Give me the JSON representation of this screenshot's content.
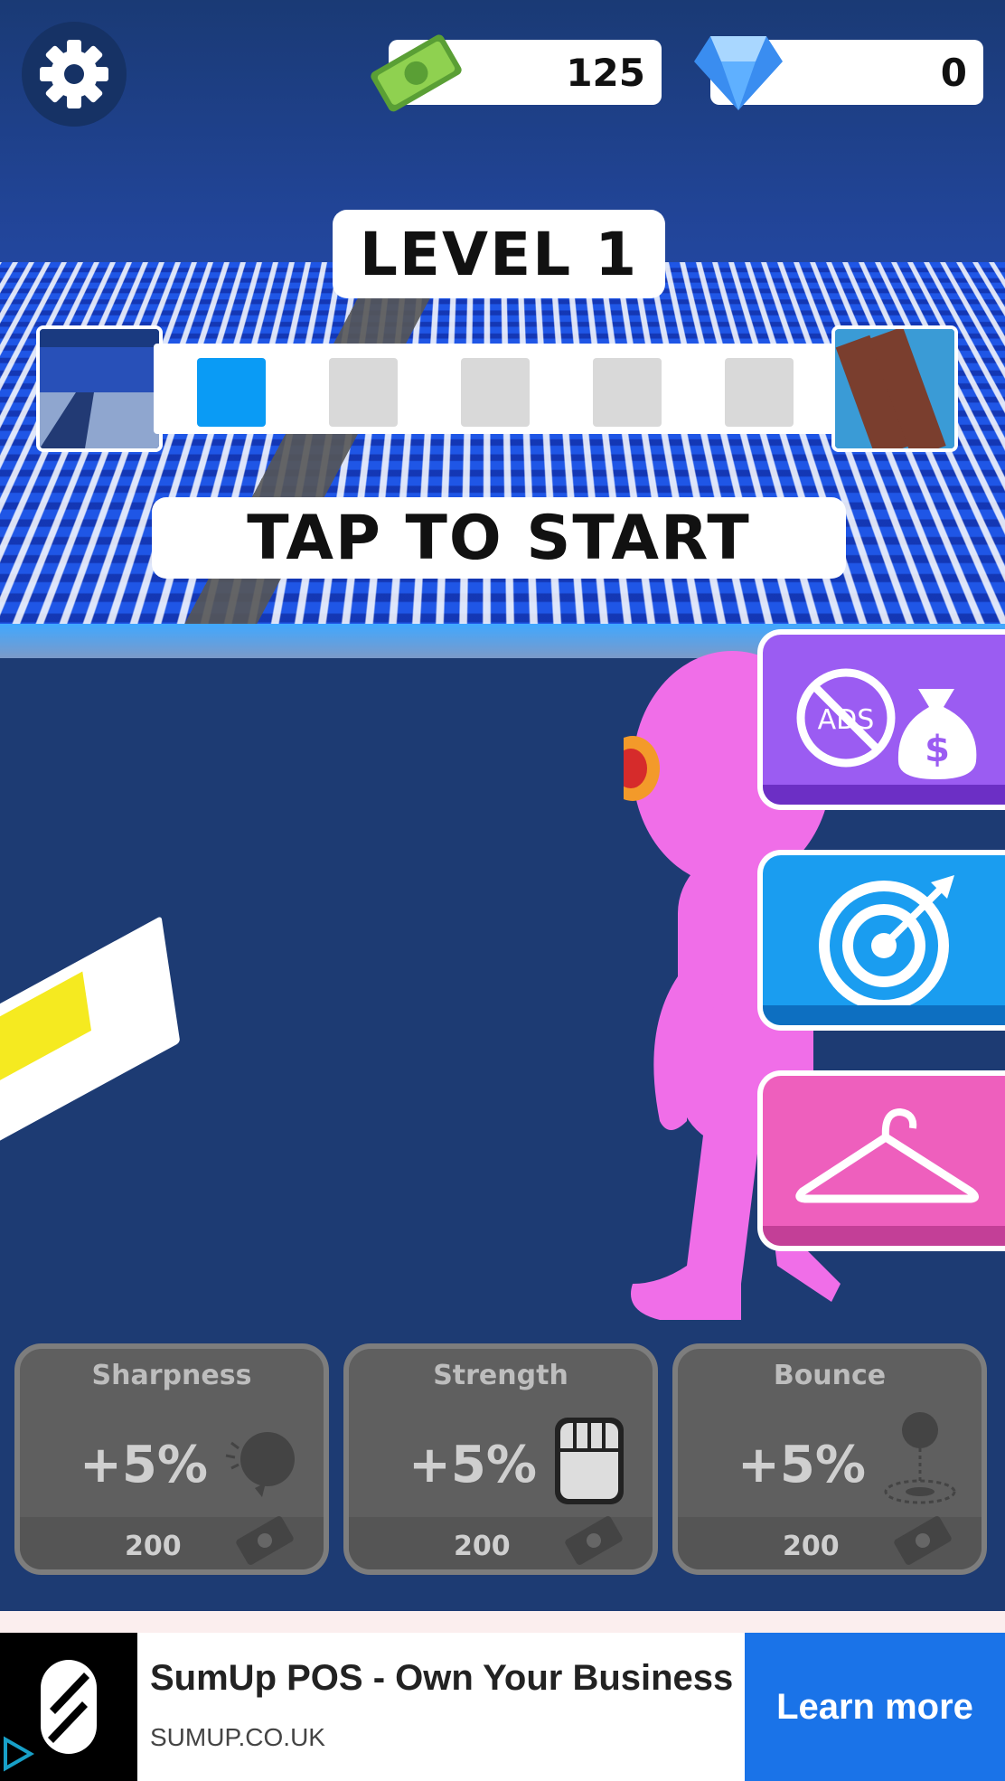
{
  "hud": {
    "cash_amount": "125",
    "gem_amount": "0"
  },
  "level": {
    "title": "LEVEL 1",
    "stages_total": 5,
    "stages_completed": 1,
    "prompt": "TAP TO START"
  },
  "side_buttons": [
    {
      "name": "no-ads-offer",
      "icon": "no-ads-money-bag-icon",
      "color": "#9b5cf2"
    },
    {
      "name": "target",
      "icon": "target-dart-icon",
      "color": "#1a9df0"
    },
    {
      "name": "skins",
      "icon": "hanger-icon",
      "color": "#ee5fbd"
    }
  ],
  "upgrades": [
    {
      "label": "Sharpness",
      "bonus": "+5%",
      "cost": "200",
      "icon": "popped-balloon-icon"
    },
    {
      "label": "Strength",
      "bonus": "+5%",
      "cost": "200",
      "icon": "fist-icon"
    },
    {
      "label": "Bounce",
      "bonus": "+5%",
      "cost": "200",
      "icon": "bouncing-ball-icon"
    }
  ],
  "ad": {
    "title": "SumUp POS - Own Your Business",
    "domain": "SUMUP.CO.UK",
    "cta": "Learn more"
  },
  "colors": {
    "stage_done": "#0a9bf5",
    "stage_pending": "#d9d9d9",
    "figure": "#f06ee8"
  }
}
